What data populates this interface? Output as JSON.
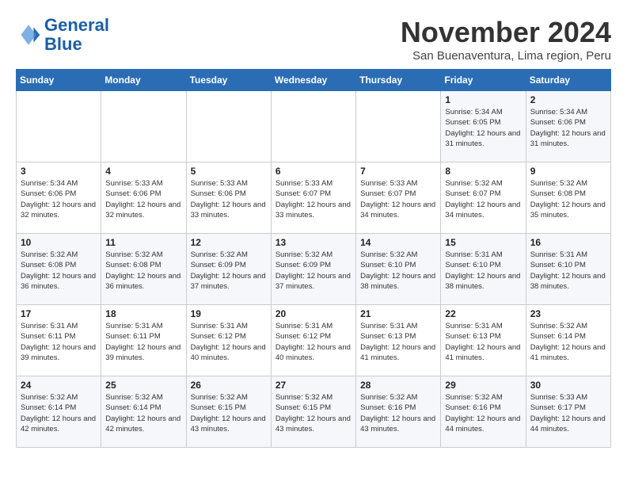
{
  "logo": {
    "line1": "General",
    "line2": "Blue"
  },
  "title": "November 2024",
  "subtitle": "San Buenaventura, Lima region, Peru",
  "weekdays": [
    "Sunday",
    "Monday",
    "Tuesday",
    "Wednesday",
    "Thursday",
    "Friday",
    "Saturday"
  ],
  "weeks": [
    [
      {
        "day": "",
        "info": ""
      },
      {
        "day": "",
        "info": ""
      },
      {
        "day": "",
        "info": ""
      },
      {
        "day": "",
        "info": ""
      },
      {
        "day": "",
        "info": ""
      },
      {
        "day": "1",
        "info": "Sunrise: 5:34 AM\nSunset: 6:05 PM\nDaylight: 12 hours and 31 minutes."
      },
      {
        "day": "2",
        "info": "Sunrise: 5:34 AM\nSunset: 6:06 PM\nDaylight: 12 hours and 31 minutes."
      }
    ],
    [
      {
        "day": "3",
        "info": "Sunrise: 5:34 AM\nSunset: 6:06 PM\nDaylight: 12 hours and 32 minutes."
      },
      {
        "day": "4",
        "info": "Sunrise: 5:33 AM\nSunset: 6:06 PM\nDaylight: 12 hours and 32 minutes."
      },
      {
        "day": "5",
        "info": "Sunrise: 5:33 AM\nSunset: 6:06 PM\nDaylight: 12 hours and 33 minutes."
      },
      {
        "day": "6",
        "info": "Sunrise: 5:33 AM\nSunset: 6:07 PM\nDaylight: 12 hours and 33 minutes."
      },
      {
        "day": "7",
        "info": "Sunrise: 5:33 AM\nSunset: 6:07 PM\nDaylight: 12 hours and 34 minutes."
      },
      {
        "day": "8",
        "info": "Sunrise: 5:32 AM\nSunset: 6:07 PM\nDaylight: 12 hours and 34 minutes."
      },
      {
        "day": "9",
        "info": "Sunrise: 5:32 AM\nSunset: 6:08 PM\nDaylight: 12 hours and 35 minutes."
      }
    ],
    [
      {
        "day": "10",
        "info": "Sunrise: 5:32 AM\nSunset: 6:08 PM\nDaylight: 12 hours and 36 minutes."
      },
      {
        "day": "11",
        "info": "Sunrise: 5:32 AM\nSunset: 6:08 PM\nDaylight: 12 hours and 36 minutes."
      },
      {
        "day": "12",
        "info": "Sunrise: 5:32 AM\nSunset: 6:09 PM\nDaylight: 12 hours and 37 minutes."
      },
      {
        "day": "13",
        "info": "Sunrise: 5:32 AM\nSunset: 6:09 PM\nDaylight: 12 hours and 37 minutes."
      },
      {
        "day": "14",
        "info": "Sunrise: 5:32 AM\nSunset: 6:10 PM\nDaylight: 12 hours and 38 minutes."
      },
      {
        "day": "15",
        "info": "Sunrise: 5:31 AM\nSunset: 6:10 PM\nDaylight: 12 hours and 38 minutes."
      },
      {
        "day": "16",
        "info": "Sunrise: 5:31 AM\nSunset: 6:10 PM\nDaylight: 12 hours and 38 minutes."
      }
    ],
    [
      {
        "day": "17",
        "info": "Sunrise: 5:31 AM\nSunset: 6:11 PM\nDaylight: 12 hours and 39 minutes."
      },
      {
        "day": "18",
        "info": "Sunrise: 5:31 AM\nSunset: 6:11 PM\nDaylight: 12 hours and 39 minutes."
      },
      {
        "day": "19",
        "info": "Sunrise: 5:31 AM\nSunset: 6:12 PM\nDaylight: 12 hours and 40 minutes."
      },
      {
        "day": "20",
        "info": "Sunrise: 5:31 AM\nSunset: 6:12 PM\nDaylight: 12 hours and 40 minutes."
      },
      {
        "day": "21",
        "info": "Sunrise: 5:31 AM\nSunset: 6:13 PM\nDaylight: 12 hours and 41 minutes."
      },
      {
        "day": "22",
        "info": "Sunrise: 5:31 AM\nSunset: 6:13 PM\nDaylight: 12 hours and 41 minutes."
      },
      {
        "day": "23",
        "info": "Sunrise: 5:32 AM\nSunset: 6:14 PM\nDaylight: 12 hours and 41 minutes."
      }
    ],
    [
      {
        "day": "24",
        "info": "Sunrise: 5:32 AM\nSunset: 6:14 PM\nDaylight: 12 hours and 42 minutes."
      },
      {
        "day": "25",
        "info": "Sunrise: 5:32 AM\nSunset: 6:14 PM\nDaylight: 12 hours and 42 minutes."
      },
      {
        "day": "26",
        "info": "Sunrise: 5:32 AM\nSunset: 6:15 PM\nDaylight: 12 hours and 43 minutes."
      },
      {
        "day": "27",
        "info": "Sunrise: 5:32 AM\nSunset: 6:15 PM\nDaylight: 12 hours and 43 minutes."
      },
      {
        "day": "28",
        "info": "Sunrise: 5:32 AM\nSunset: 6:16 PM\nDaylight: 12 hours and 43 minutes."
      },
      {
        "day": "29",
        "info": "Sunrise: 5:32 AM\nSunset: 6:16 PM\nDaylight: 12 hours and 44 minutes."
      },
      {
        "day": "30",
        "info": "Sunrise: 5:33 AM\nSunset: 6:17 PM\nDaylight: 12 hours and 44 minutes."
      }
    ]
  ]
}
